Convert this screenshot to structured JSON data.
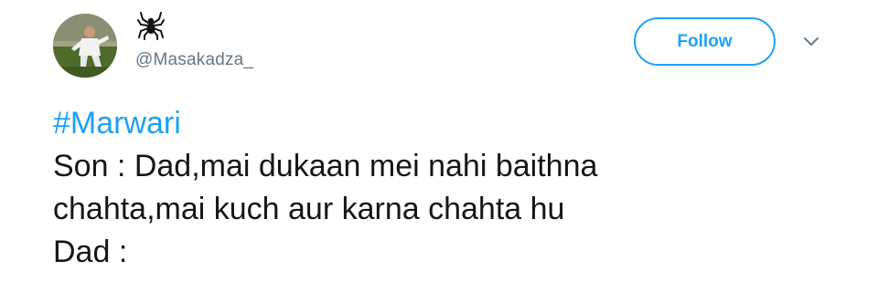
{
  "author": {
    "display_icon": "spider-icon",
    "handle": "@Masakadza_",
    "avatar": "avatar-photo"
  },
  "follow_button": {
    "label": "Follow"
  },
  "menu_icon": "chevron-down-icon",
  "tweet": {
    "hashtag": "#Marwari",
    "lines": [
      "Son : Dad,mai dukaan mei nahi baithna",
      "chahta,mai kuch aur karna chahta hu",
      "Dad :"
    ]
  },
  "colors": {
    "accent": "#1da1f2",
    "text": "#14171a",
    "muted": "#657786"
  }
}
